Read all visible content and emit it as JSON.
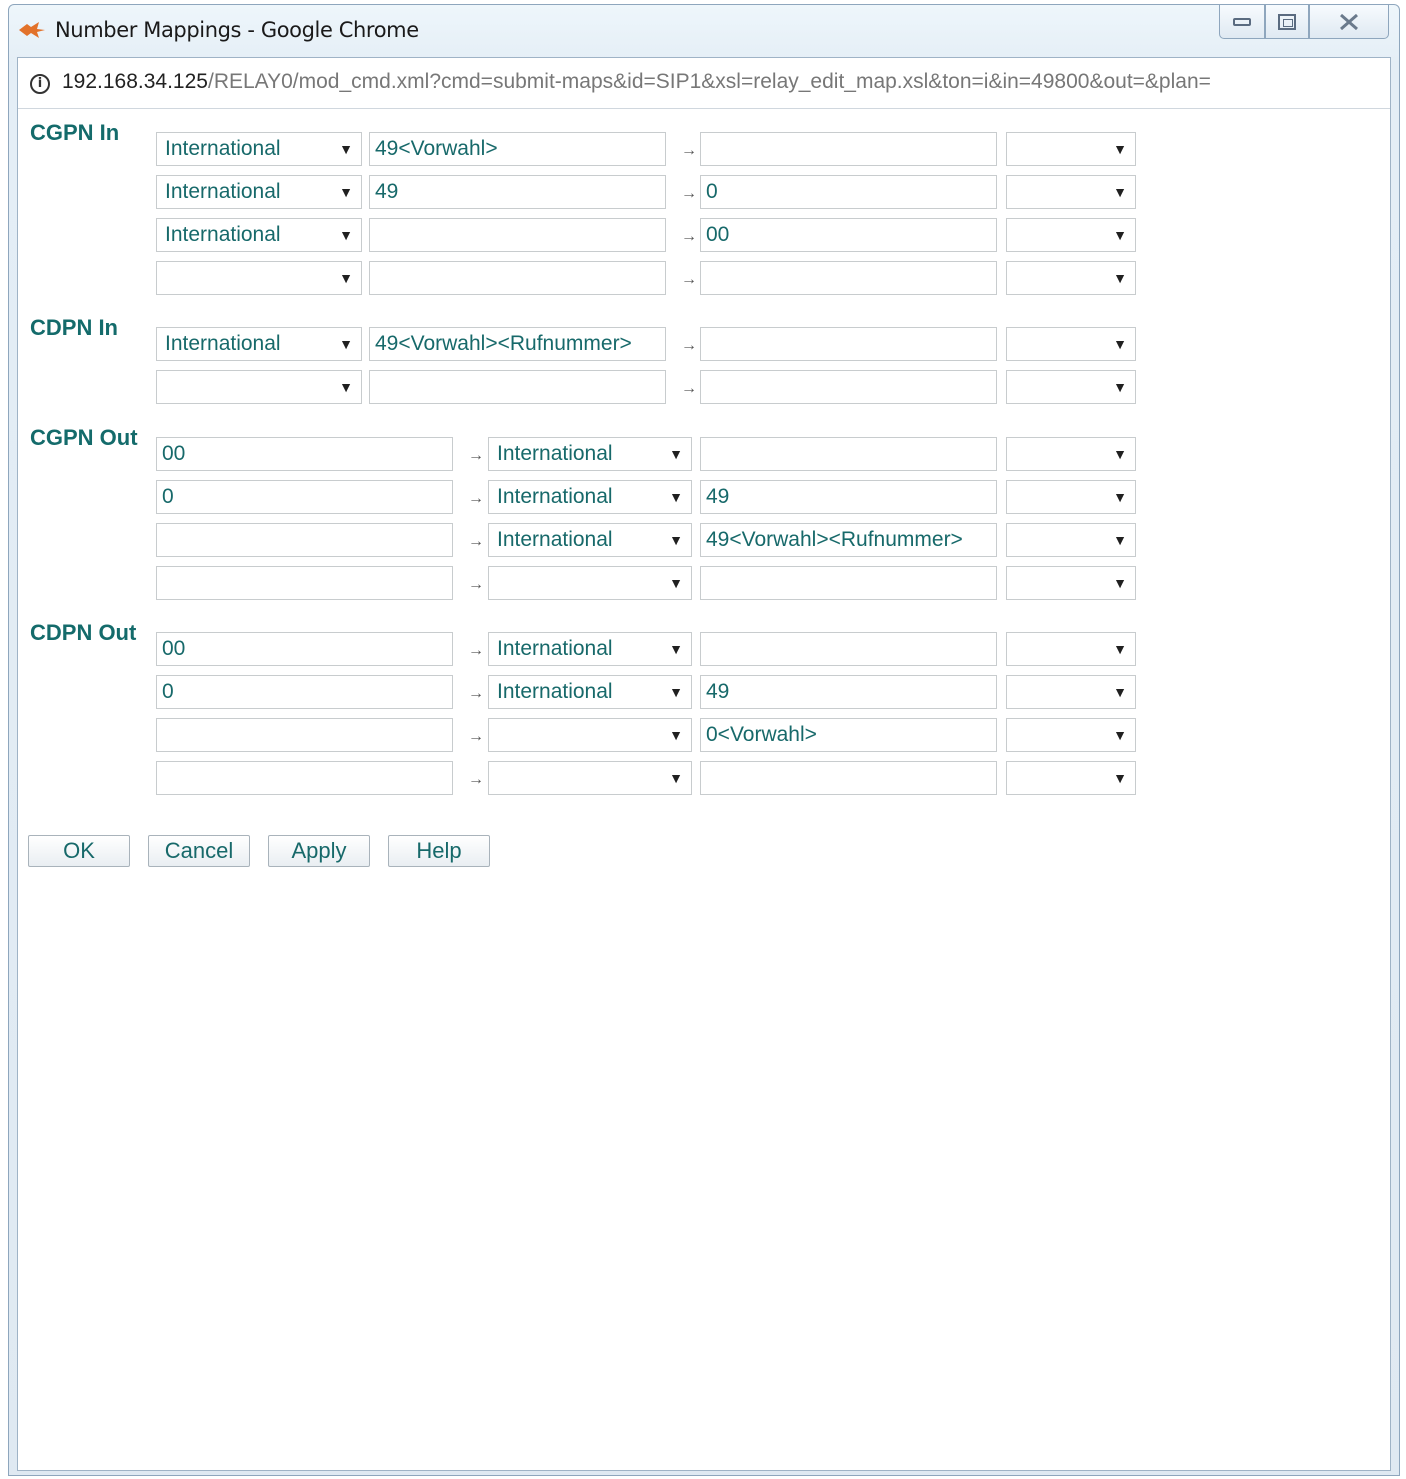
{
  "window": {
    "title": "Number Mappings - Google Chrome"
  },
  "address_bar": {
    "host": "192.168.34.125",
    "path": "/RELAY0/mod_cmd.xml?cmd=submit-maps&id=SIP1&xsl=relay_edit_map.xsl&ton=i&in=49800&out=&plan="
  },
  "arrow_glyph": "→",
  "dropdown_glyph": "▼",
  "sections": {
    "cgpn_in": {
      "label": "CGPN In",
      "rows": [
        {
          "ton": "International",
          "match": "49<Vorwahl>",
          "replace": "",
          "plan": ""
        },
        {
          "ton": "International",
          "match": "49",
          "replace": "0",
          "plan": ""
        },
        {
          "ton": "International",
          "match": "",
          "replace": "00",
          "plan": ""
        },
        {
          "ton": "",
          "match": "",
          "replace": "",
          "plan": ""
        }
      ]
    },
    "cdpn_in": {
      "label": "CDPN In",
      "rows": [
        {
          "ton": "International",
          "match": "49<Vorwahl><Rufnummer>",
          "replace": "",
          "plan": ""
        },
        {
          "ton": "",
          "match": "",
          "replace": "",
          "plan": ""
        }
      ]
    },
    "cgpn_out": {
      "label": "CGPN Out",
      "rows": [
        {
          "match": "00",
          "ton": "International",
          "replace": "",
          "plan": ""
        },
        {
          "match": "0",
          "ton": "International",
          "replace": "49",
          "plan": ""
        },
        {
          "match": "",
          "ton": "International",
          "replace": "49<Vorwahl><Rufnummer>",
          "plan": ""
        },
        {
          "match": "",
          "ton": "",
          "replace": "",
          "plan": ""
        }
      ]
    },
    "cdpn_out": {
      "label": "CDPN Out",
      "rows": [
        {
          "match": "00",
          "ton": "International",
          "replace": "",
          "plan": ""
        },
        {
          "match": "0",
          "ton": "International",
          "replace": "49",
          "plan": ""
        },
        {
          "match": "",
          "ton": "",
          "replace": "0<Vorwahl>",
          "plan": ""
        },
        {
          "match": "",
          "ton": "",
          "replace": "",
          "plan": ""
        }
      ]
    }
  },
  "buttons": {
    "ok": "OK",
    "cancel": "Cancel",
    "apply": "Apply",
    "help": "Help"
  },
  "colors": {
    "text": "#17696a",
    "label": "#146b6b"
  }
}
